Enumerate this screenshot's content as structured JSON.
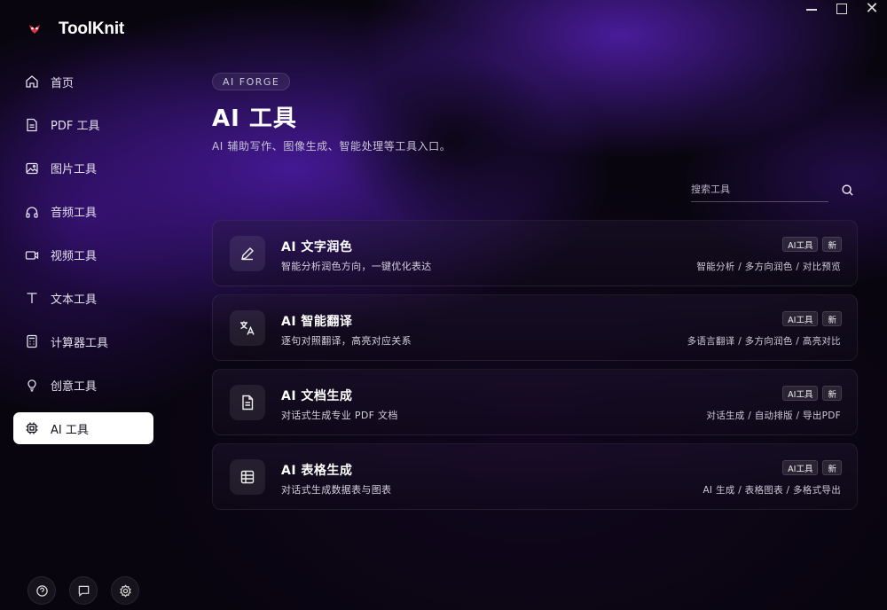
{
  "app": {
    "name": "ToolKnit"
  },
  "window_controls": {
    "minimize": "—",
    "maximize": "□",
    "close": "✕"
  },
  "sidebar": {
    "items": [
      {
        "label": "首页",
        "icon": "home-icon",
        "active": false
      },
      {
        "label": "PDF 工具",
        "icon": "document-icon",
        "active": false
      },
      {
        "label": "图片工具",
        "icon": "image-icon",
        "active": false
      },
      {
        "label": "音频工具",
        "icon": "headphones-icon",
        "active": false
      },
      {
        "label": "视频工具",
        "icon": "video-icon",
        "active": false
      },
      {
        "label": "文本工具",
        "icon": "text-icon",
        "active": false
      },
      {
        "label": "计算器工具",
        "icon": "calculator-icon",
        "active": false
      },
      {
        "label": "创意工具",
        "icon": "lightbulb-icon",
        "active": false
      },
      {
        "label": "AI 工具",
        "icon": "chip-icon",
        "active": true
      }
    ],
    "bottom_icons": [
      "feedback-icon",
      "message-icon",
      "settings-icon"
    ]
  },
  "header": {
    "pill": "AI FORGE",
    "title": "AI 工具",
    "subtitle": "AI 辅助写作、图像生成、智能处理等工具入口。"
  },
  "search": {
    "placeholder": "搜索工具",
    "value": ""
  },
  "cards": [
    {
      "title": "AI 文字润色",
      "desc": "智能分析润色方向，一键优化表达",
      "icon": "pen-icon",
      "badges": [
        "AI工具",
        "新"
      ],
      "tags": "智能分析 / 多方向润色 / 对比预览"
    },
    {
      "title": "AI 智能翻译",
      "desc": "逐句对照翻译，高亮对应关系",
      "icon": "translate-icon",
      "badges": [
        "AI工具",
        "新"
      ],
      "tags": "多语言翻译 / 多方向润色 / 高亮对比"
    },
    {
      "title": "AI 文档生成",
      "desc": "对话式生成专业 PDF 文档",
      "icon": "file-text-icon",
      "badges": [
        "AI工具",
        "新"
      ],
      "tags": "对话生成 / 自动排版 / 导出PDF"
    },
    {
      "title": "AI 表格生成",
      "desc": "对话式生成数据表与图表",
      "icon": "table-icon",
      "badges": [
        "AI工具",
        "新"
      ],
      "tags": "AI 生成 / 表格图表 / 多格式导出"
    }
  ],
  "colors": {
    "accent": "#5b23c8",
    "active_bg": "#ffffff",
    "background": "#0a0710"
  }
}
